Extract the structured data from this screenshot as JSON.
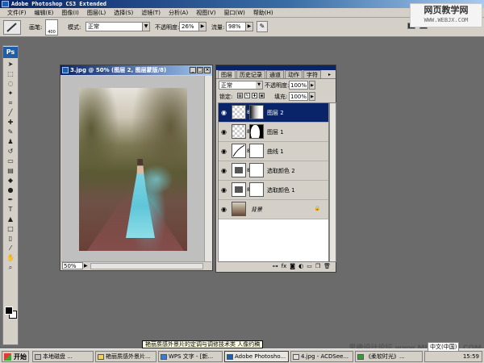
{
  "app": {
    "title": "Adobe Photoshop CS3 Extended",
    "watermark_line1": "网页教学网",
    "watermark_line2": "WWW.WEBJX.COM"
  },
  "menu": [
    "文件(F)",
    "编辑(E)",
    "图像(I)",
    "图层(L)",
    "选择(S)",
    "滤镜(T)",
    "分析(A)",
    "视图(V)",
    "窗口(W)",
    "帮助(H)"
  ],
  "options": {
    "brush_label": "画笔:",
    "brush_size": "400",
    "mode_label": "模式:",
    "mode_value": "正常",
    "opacity_label": "不透明度:",
    "opacity_value": "26%",
    "flow_label": "流量:",
    "flow_value": "98%"
  },
  "toolbox": {
    "logo": "Ps"
  },
  "document": {
    "title": "3.jpg @ 50% (图层 2, 图层蒙版/8)",
    "zoom": "50%"
  },
  "layers_panel": {
    "tabs": [
      "图层",
      "历史记录",
      "通道",
      "动作",
      "字符"
    ],
    "blend_mode": "正常",
    "opacity_label": "不透明度:",
    "opacity_value": "100%",
    "lock_label": "锁定:",
    "fill_label": "填充:",
    "fill_value": "100%",
    "layers": [
      {
        "name": "图层 2",
        "selected": true
      },
      {
        "name": "图层 1",
        "selected": false
      },
      {
        "name": "曲线 1",
        "selected": false
      },
      {
        "name": "选取颜色 2",
        "selected": false
      },
      {
        "name": "选取颜色 1",
        "selected": false
      },
      {
        "name": "背景",
        "selected": false
      }
    ]
  },
  "tooltip": "艳丽质感外景片的定调与调修技术类 人像约稿",
  "taskbar": {
    "start": "开始",
    "buttons": [
      "本地磁盘 ...",
      "艳丽质感外景片...",
      "WPS 文字 - [新...",
      "Adobe Photosho...",
      "4.jpg - ACDSee...",
      "《柔软时光》..."
    ],
    "clock": "15:59",
    "footer_watermark": "思缘设计论坛 www.MISSYUAN.COM",
    "lang": "中文(中国)"
  }
}
